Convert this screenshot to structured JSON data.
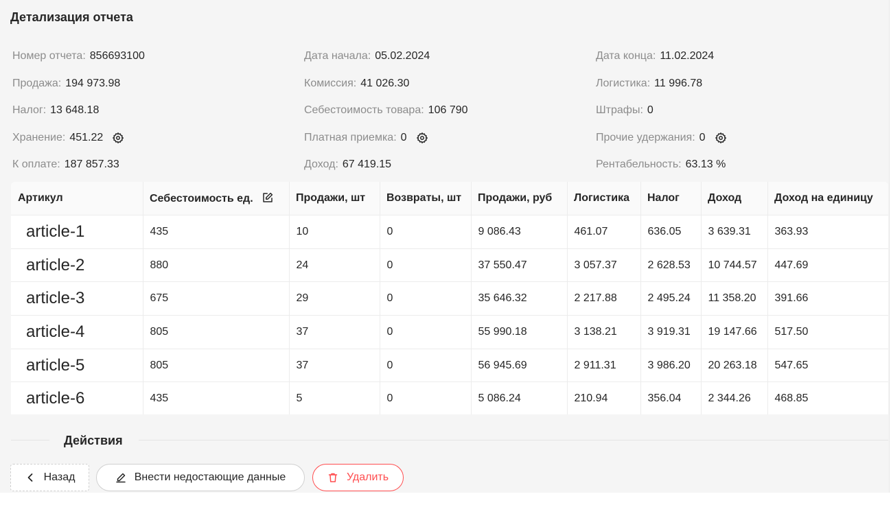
{
  "page": {
    "title": "Детализация отчета"
  },
  "stats": {
    "report_number": {
      "label": "Номер отчета",
      "value": "856693100"
    },
    "start_date": {
      "label": "Дата начала",
      "value": "05.02.2024"
    },
    "end_date": {
      "label": "Дата конца",
      "value": "11.02.2024"
    },
    "sale": {
      "label": "Продажа",
      "value": "194 973.98"
    },
    "commission": {
      "label": "Комиссия",
      "value": "41 026.30"
    },
    "logistics": {
      "label": "Логистика",
      "value": "11 996.78"
    },
    "tax": {
      "label": "Налог",
      "value": "13 648.18"
    },
    "cost": {
      "label": "Себестоимость товара",
      "value": "106 790"
    },
    "fines": {
      "label": "Штрафы",
      "value": "0"
    },
    "storage": {
      "label": "Хранение",
      "value": "451.22"
    },
    "paid_acceptance": {
      "label": "Платная приемка",
      "value": "0"
    },
    "other_deductions": {
      "label": "Прочие удержания",
      "value": "0"
    },
    "to_pay": {
      "label": "К оплате",
      "value": "187 857.33"
    },
    "income": {
      "label": "Доход",
      "value": "67 419.15"
    },
    "profitability": {
      "label": "Рентабельность",
      "value": "63.13 %"
    }
  },
  "table": {
    "columns": [
      "Артикул",
      "Себестоимость ед.",
      "Продажи, шт",
      "Возвраты, шт",
      "Продажи, руб",
      "Логистика",
      "Налог",
      "Доход",
      "Доход на единицу"
    ],
    "rows": [
      [
        "article-1",
        "435",
        "10",
        "0",
        "9 086.43",
        "461.07",
        "636.05",
        "3 639.31",
        "363.93"
      ],
      [
        "article-2",
        "880",
        "24",
        "0",
        "37 550.47",
        "3 057.37",
        "2 628.53",
        "10 744.57",
        "447.69"
      ],
      [
        "article-3",
        "675",
        "29",
        "0",
        "35 646.32",
        "2 217.88",
        "2 495.24",
        "11 358.20",
        "391.66"
      ],
      [
        "article-4",
        "805",
        "37",
        "0",
        "55 990.18",
        "3 138.21",
        "3 919.31",
        "19 147.66",
        "517.50"
      ],
      [
        "article-5",
        "805",
        "37",
        "0",
        "56 945.69",
        "2 911.31",
        "3 986.20",
        "20 263.18",
        "547.65"
      ],
      [
        "article-6",
        "435",
        "5",
        "0",
        "5 086.24",
        "210.94",
        "356.04",
        "2 344.26",
        "468.85"
      ]
    ]
  },
  "actions": {
    "title": "Действия",
    "back_label": "Назад",
    "fill_label": "Внести недостающие данные",
    "delete_label": "Удалить",
    "delete_color": "#ff4d4f"
  },
  "icons": {
    "gear": "gear-icon",
    "edit": "edit-icon",
    "back": "chevron-left-icon",
    "fill": "pencil-icon",
    "delete": "trash-icon"
  }
}
